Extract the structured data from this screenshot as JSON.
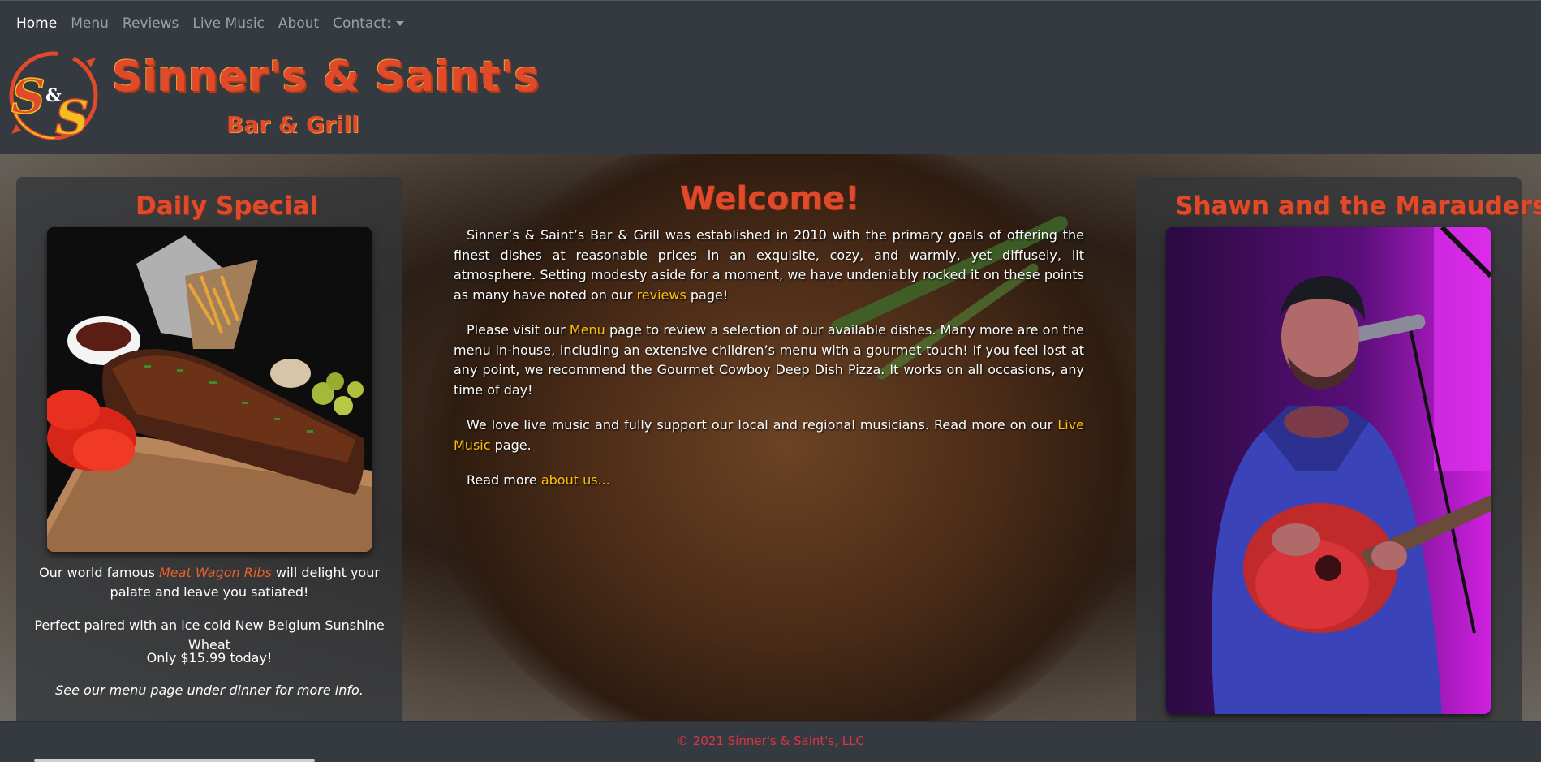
{
  "nav": {
    "items": [
      {
        "label": "Home"
      },
      {
        "label": "Menu"
      },
      {
        "label": "Reviews"
      },
      {
        "label": "Live Music"
      },
      {
        "label": "About"
      },
      {
        "label": "Contact:"
      }
    ]
  },
  "brand": {
    "logo_text": "S&S",
    "title": "Sinner's & Saint's",
    "subtitle": "Bar & Grill"
  },
  "left_panel": {
    "title": "Daily Special",
    "line1_before": "Our world famous ",
    "line1_highlight": "Meat Wagon Ribs",
    "line1_after": " will delight your palate and leave you satiated!",
    "line2": "Perfect paired with an ice cold New Belgium Sunshine Wheat",
    "line3": "Only $15.99 today!",
    "line4": "See our menu page under dinner for more info."
  },
  "center": {
    "title": "Welcome!",
    "p1_before": "Sinner’s & Saint’s Bar & Grill was established in 2010 with the primary goals of offering the finest dishes at reasonable prices in an exquisite, cozy, and warmly, yet diffusely, lit atmosphere. Setting modesty aside for a moment, we have undeniably rocked it on these points as many have noted on our ",
    "p1_link": "reviews",
    "p1_after": " page!",
    "p2_before": "Please visit our ",
    "p2_link": "Menu",
    "p2_after": " page to review a selection of our available dishes. Many more are on the menu in-house, including an extensive children’s menu with a gourmet touch! If you feel lost at any point, we recommend the Gourmet Cowboy Deep Dish Pizza. It works on all occasions, any time of day!",
    "p3_before": "We love live music and fully support our local and regional musicians. Read more on our ",
    "p3_link": "Live Music",
    "p3_after": " page.",
    "p4_before": "Read more ",
    "p4_link": "about us..."
  },
  "right_panel": {
    "title": "Shawn and the Marauders"
  },
  "footer": {
    "text": "© 2021 Sinner's & Saint's, LLC"
  },
  "colors": {
    "accent": "#e04a2b",
    "link": "#ffc107",
    "header_bg": "#343a40",
    "footer_text": "#dc3545"
  }
}
